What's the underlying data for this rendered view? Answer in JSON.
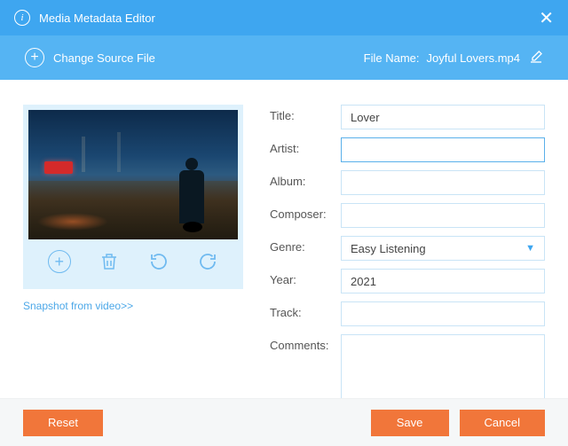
{
  "window": {
    "title": "Media Metadata Editor"
  },
  "subheader": {
    "change_source": "Change Source File",
    "file_name_label": "File Name:",
    "file_name_value": "Joyful Lovers.mp4"
  },
  "left": {
    "snapshot_link": "Snapshot from video>>"
  },
  "fields": {
    "title_label": "Title:",
    "title_value": "Lover",
    "artist_label": "Artist:",
    "artist_value": "",
    "album_label": "Album:",
    "album_value": "",
    "composer_label": "Composer:",
    "composer_value": "",
    "genre_label": "Genre:",
    "genre_value": "Easy Listening",
    "year_label": "Year:",
    "year_value": "2021",
    "track_label": "Track:",
    "track_value": "",
    "comments_label": "Comments:",
    "comments_value": ""
  },
  "footer": {
    "reset": "Reset",
    "save": "Save",
    "cancel": "Cancel"
  }
}
